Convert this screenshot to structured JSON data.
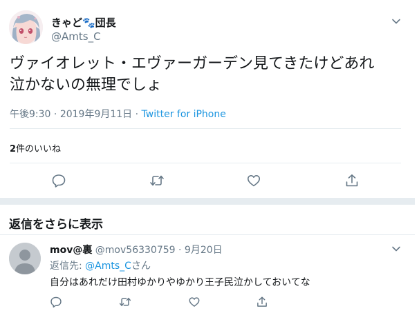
{
  "main_tweet": {
    "display_name": "きゃど🐾団長",
    "handle": "@Amts_C",
    "text_line1": "ヴァイオレット・エヴァーガーデン見てきたけどあれ",
    "text_line2": "泣かないの無理でしょ",
    "time": "午後9:30",
    "sep": " · ",
    "date": "2019年9月11日",
    "source": "Twitter for iPhone",
    "likes_count": "2",
    "likes_label": "件のいいね"
  },
  "section": {
    "more_replies": "返信をさらに表示"
  },
  "reply": {
    "display_name": "mov@裏",
    "handle": "@mov56330759",
    "sep": " · ",
    "date": "9月20日",
    "reply_to_prefix": "返信先: ",
    "reply_to_mention": "@Amts_C",
    "reply_to_suffix": "さん",
    "text": "自分はあれだけ田村ゆかりやゆかり王子民泣かしておいてな"
  },
  "colors": {
    "text": "#14171a",
    "secondary": "#657786",
    "link": "#1b95e0",
    "divider": "#e6ecf0"
  },
  "icons": [
    "reply-icon",
    "retweet-icon",
    "like-icon",
    "share-icon",
    "chevron-down-icon",
    "default-avatar-icon"
  ]
}
